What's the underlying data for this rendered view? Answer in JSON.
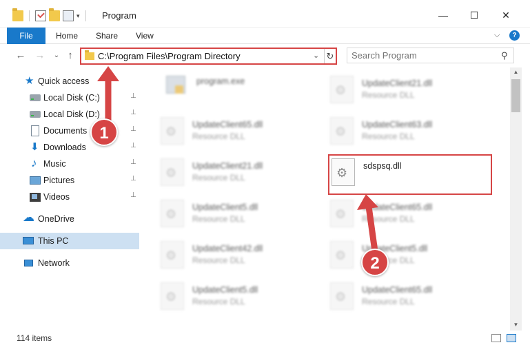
{
  "window": {
    "title": "Program",
    "minimize": "—",
    "maximize": "☐",
    "close": "✕"
  },
  "ribbon": {
    "tabs": [
      "File",
      "Home",
      "Share",
      "View"
    ],
    "chevron": "⌵",
    "help": "?"
  },
  "navbar": {
    "back": "←",
    "forward": "→",
    "recent": "⌄",
    "up": "↑",
    "address_path": "C:\\Program Files\\Program Directory",
    "address_dropdown": "⌄",
    "refresh": "↻",
    "search_placeholder": "Search Program",
    "search_icon": "⚲"
  },
  "sidebar": {
    "items": [
      {
        "label": "Quick access",
        "icon": "star-icon",
        "pinned": false
      },
      {
        "label": "Local Disk (C:)",
        "icon": "disk-icon",
        "pinned": true
      },
      {
        "label": "Local Disk (D:)",
        "icon": "disk-icon",
        "pinned": true
      },
      {
        "label": "Documents",
        "icon": "documents-icon",
        "pinned": true
      },
      {
        "label": "Downloads",
        "icon": "downloads-icon",
        "pinned": true
      },
      {
        "label": "Music",
        "icon": "music-icon",
        "pinned": true
      },
      {
        "label": "Pictures",
        "icon": "pictures-icon",
        "pinned": true
      },
      {
        "label": "Videos",
        "icon": "videos-icon",
        "pinned": true
      },
      {
        "label": "OneDrive",
        "icon": "cloud-icon",
        "pinned": false
      },
      {
        "label": "This PC",
        "icon": "computer-icon",
        "pinned": false,
        "selected": true
      },
      {
        "label": "Network",
        "icon": "network-icon",
        "pinned": false
      }
    ],
    "pin_glyph": "📌"
  },
  "files": [
    {
      "name": "program.exe",
      "type": ""
    },
    {
      "name": "UpdateClient21.dll",
      "type": "Resource DLL"
    },
    {
      "name": "UpdateClient65.dll",
      "type": "Resource DLL"
    },
    {
      "name": "UpdateClient63.dll",
      "type": "Resource DLL"
    },
    {
      "name": "UpdateClient21.dll",
      "type": "Resource DLL"
    },
    {
      "name": "sdspsq.dll",
      "type": ""
    },
    {
      "name": "UpdateClient5.dll",
      "type": "Resource DLL"
    },
    {
      "name": "UpdateClient65.dll",
      "type": "Resource DLL"
    },
    {
      "name": "UpdateClient42.dll",
      "type": "Resource DLL"
    },
    {
      "name": "UpdateClient5.dll",
      "type": "Resource DLL"
    },
    {
      "name": "UpdateClient5.dll",
      "type": "Resource DLL"
    },
    {
      "name": "UpdateClient65.dll",
      "type": "Resource DLL"
    }
  ],
  "status": {
    "item_count": "114 items"
  },
  "annotations": {
    "step1": "1",
    "step2": "2",
    "color": "#d64545"
  }
}
